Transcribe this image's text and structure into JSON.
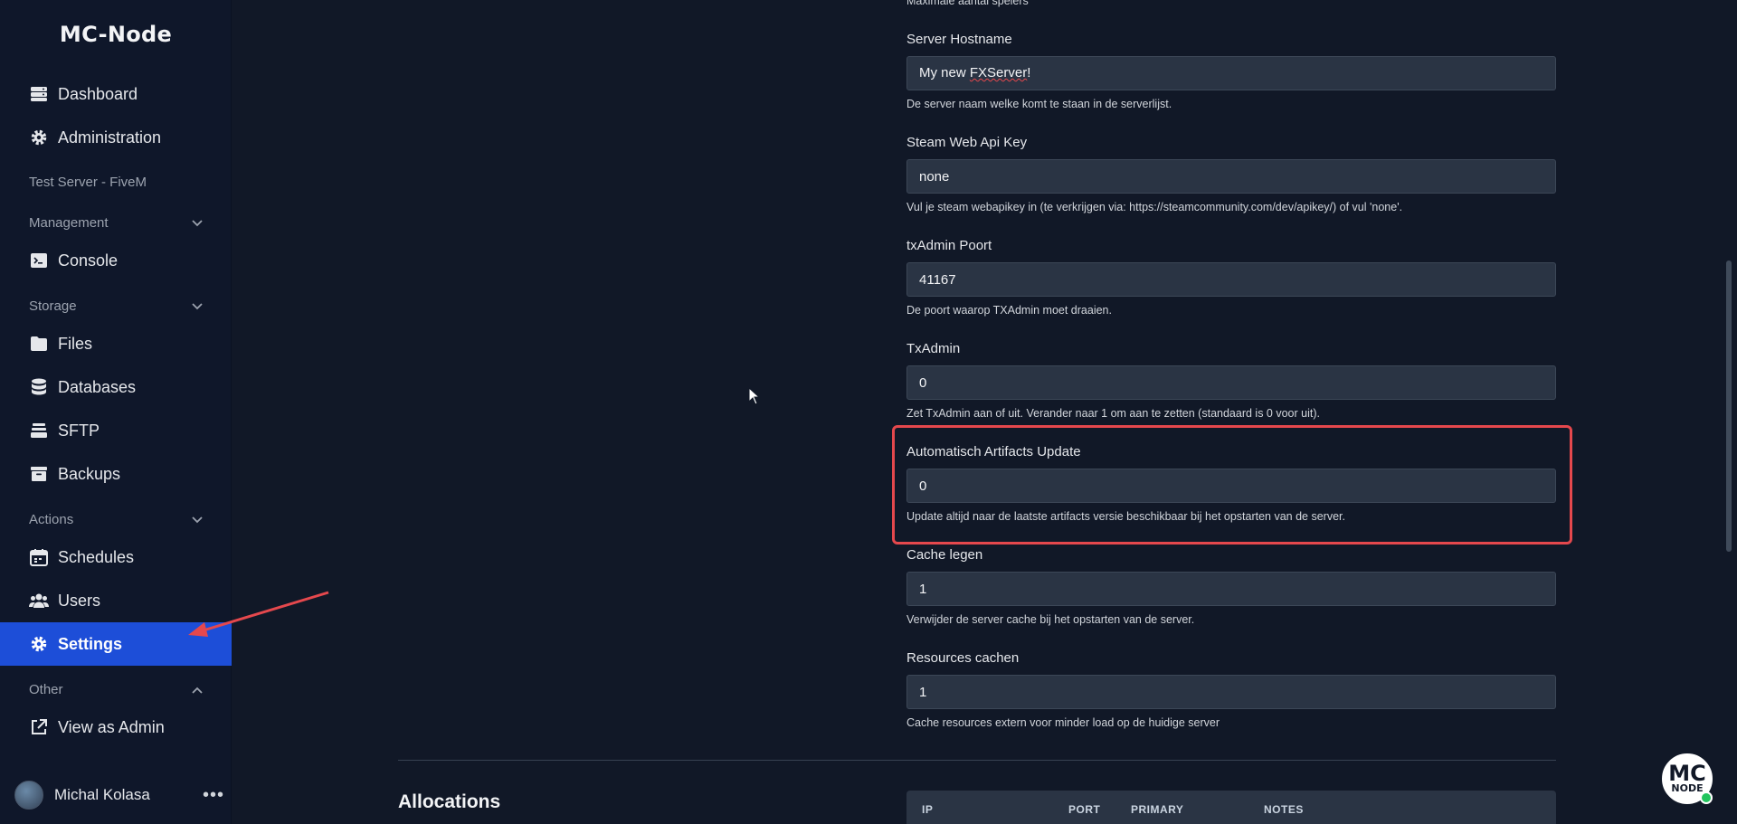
{
  "sidebar": {
    "brand": "MC-Node",
    "top_items": [
      {
        "label": "Dashboard",
        "icon": "server-stack-icon"
      },
      {
        "label": "Administration",
        "icon": "gear-icon"
      }
    ],
    "server_name": "Test Server - FiveM",
    "sections": {
      "management": "Management",
      "storage": "Storage",
      "actions": "Actions",
      "other": "Other"
    },
    "items": {
      "console": "Console",
      "files": "Files",
      "databases": "Databases",
      "sftp": "SFTP",
      "backups": "Backups",
      "schedules": "Schedules",
      "users": "Users",
      "settings": "Settings",
      "view_as_admin": "View as Admin"
    },
    "user": {
      "name": "Michal Kolasa",
      "menu": "•••"
    }
  },
  "main": {
    "top_cut_text": "Maximale aantal spelers",
    "fields": [
      {
        "label": "Server Hostname",
        "value": "My new FXServer!",
        "help": "De server naam welke komt te staan in de serverlijst."
      },
      {
        "label": "Steam Web Api Key",
        "value": "none",
        "help": "Vul je steam webapikey in (te verkrijgen via: https://steamcommunity.com/dev/apikey/) of vul 'none'."
      },
      {
        "label": "txAdmin Poort",
        "value": "41167",
        "help": "De poort waarop TXAdmin moet draaien."
      },
      {
        "label": "TxAdmin",
        "value": "0",
        "help": "Zet TxAdmin aan of uit. Verander naar 1 om aan te zetten (standaard is 0 voor uit)."
      },
      {
        "label": "Automatisch Artifacts Update",
        "value": "0",
        "help": "Update altijd naar de laatste artifacts versie beschikbaar bij het opstarten van de server."
      },
      {
        "label": "Cache legen",
        "value": "1",
        "help": "Verwijder de server cache bij het opstarten van de server."
      },
      {
        "label": "Resources cachen",
        "value": "1",
        "help": "Cache resources extern voor minder load op de huidige server"
      }
    ],
    "hostname_value_parts": {
      "pre": "My new ",
      "underlined": "FXServer",
      "post": "!"
    },
    "allocations": {
      "title": "Allocations",
      "columns": [
        "IP",
        "PORT",
        "PRIMARY",
        "NOTES"
      ]
    }
  },
  "badge": {
    "line1": "MC",
    "line2": "NODE"
  },
  "colors": {
    "accent": "#1d4ed8",
    "highlight": "#e5484d",
    "status_online": "#22c55e"
  }
}
